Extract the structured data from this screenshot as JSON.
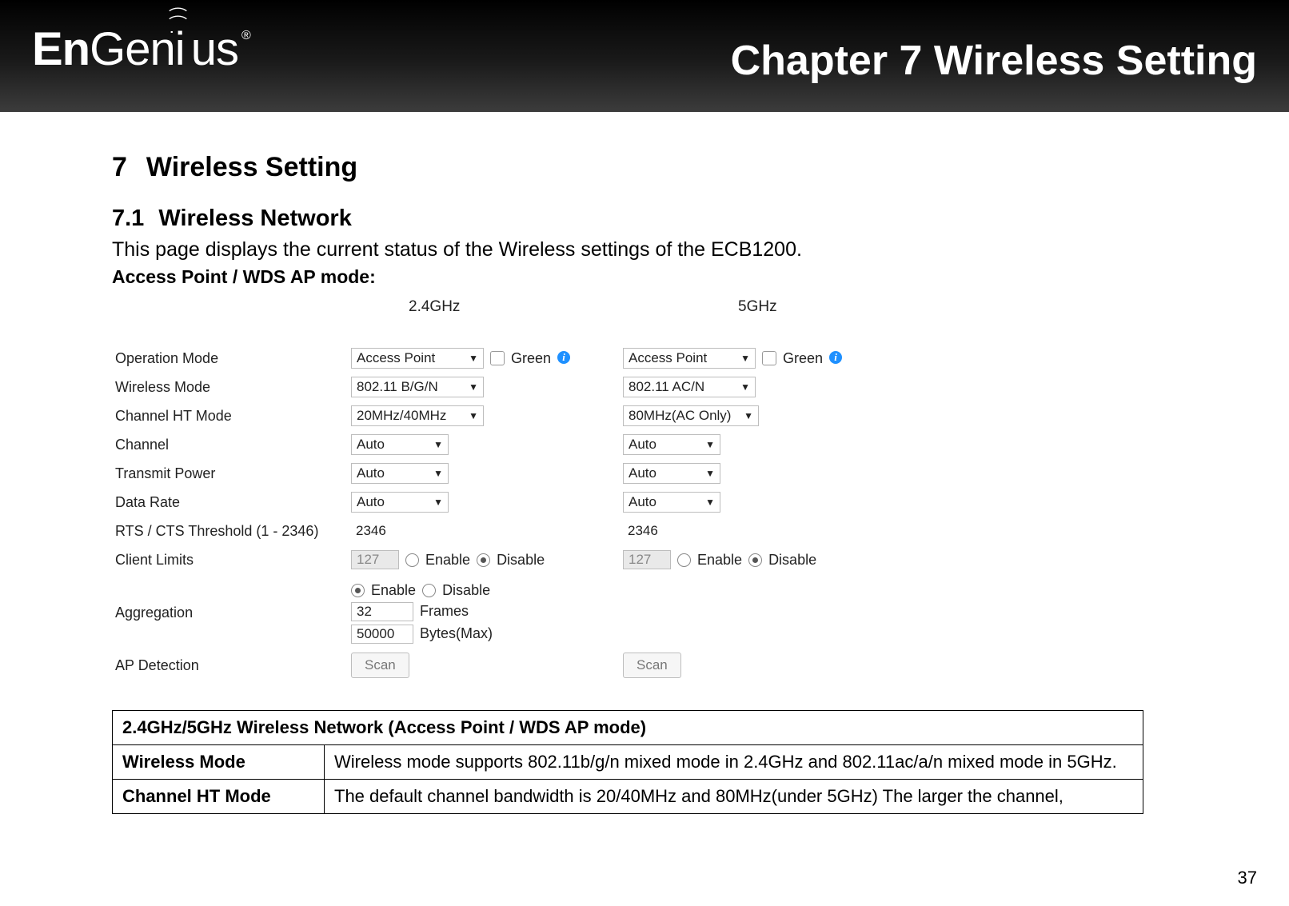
{
  "banner": {
    "logo_text": "EnGenius",
    "chapter_title": "Chapter 7  Wireless Setting"
  },
  "headings": {
    "h1_num": "7",
    "h1_txt": "Wireless Setting",
    "h2_num": "7.1",
    "h2_txt": "Wireless Network"
  },
  "intro": "This page displays the current status of the Wireless settings of the ECB1200.",
  "mode_label": "Access Point / WDS AP mode:",
  "ui": {
    "col_24_header": "2.4GHz",
    "col_5g_header": "5GHz",
    "green_label": "Green",
    "enable_label": "Enable",
    "disable_label": "Disable",
    "frames_label": "Frames",
    "bytes_label": "Bytes(Max)",
    "scan_label": "Scan",
    "rows": {
      "operation_mode": {
        "label": "Operation Mode",
        "v24": "Access Point",
        "v5g": "Access Point"
      },
      "wireless_mode": {
        "label": "Wireless Mode",
        "v24": "802.11 B/G/N",
        "v5g": "802.11 AC/N"
      },
      "channel_ht": {
        "label": "Channel HT Mode",
        "v24": "20MHz/40MHz",
        "v5g": "80MHz(AC Only)"
      },
      "channel": {
        "label": "Channel",
        "v24": "Auto",
        "v5g": "Auto"
      },
      "tx_power": {
        "label": "Transmit Power",
        "v24": "Auto",
        "v5g": "Auto"
      },
      "data_rate": {
        "label": "Data Rate",
        "v24": "Auto",
        "v5g": "Auto"
      },
      "rtscts": {
        "label": "RTS / CTS Threshold (1 - 2346)",
        "v24": "2346",
        "v5g": "2346"
      },
      "client_limits": {
        "label": "Client Limits",
        "v24": "127",
        "v5g": "127"
      },
      "aggregation": {
        "label": "Aggregation",
        "frames": "32",
        "bytes": "50000"
      },
      "ap_detection": {
        "label": "AP Detection"
      }
    }
  },
  "table": {
    "caption": "2.4GHz/5GHz Wireless Network (Access Point / WDS AP mode)",
    "rows": [
      {
        "k": "Wireless Mode",
        "v": "Wireless mode supports 802.11b/g/n mixed mode in 2.4GHz and 802.11ac/a/n mixed mode in 5GHz."
      },
      {
        "k": "Channel HT Mode",
        "v": "The default channel bandwidth is 20/40MHz and 80MHz(under 5GHz) The larger the channel,"
      }
    ]
  },
  "page_number": "37"
}
